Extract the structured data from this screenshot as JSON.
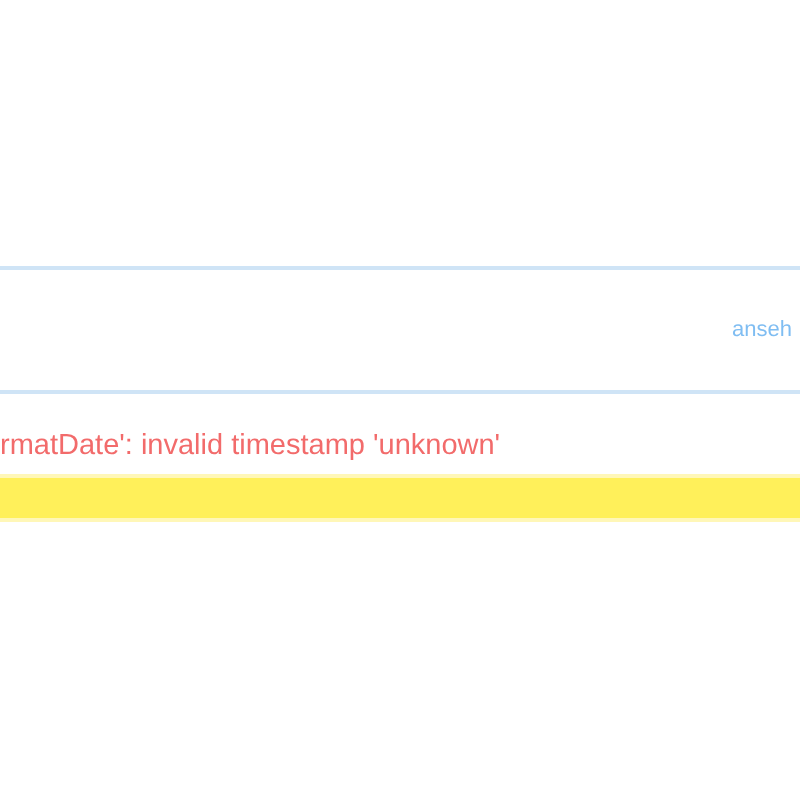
{
  "panel": {
    "link": "anseh"
  },
  "error": {
    "message": "rmatDate': invalid timestamp 'unknown'"
  }
}
